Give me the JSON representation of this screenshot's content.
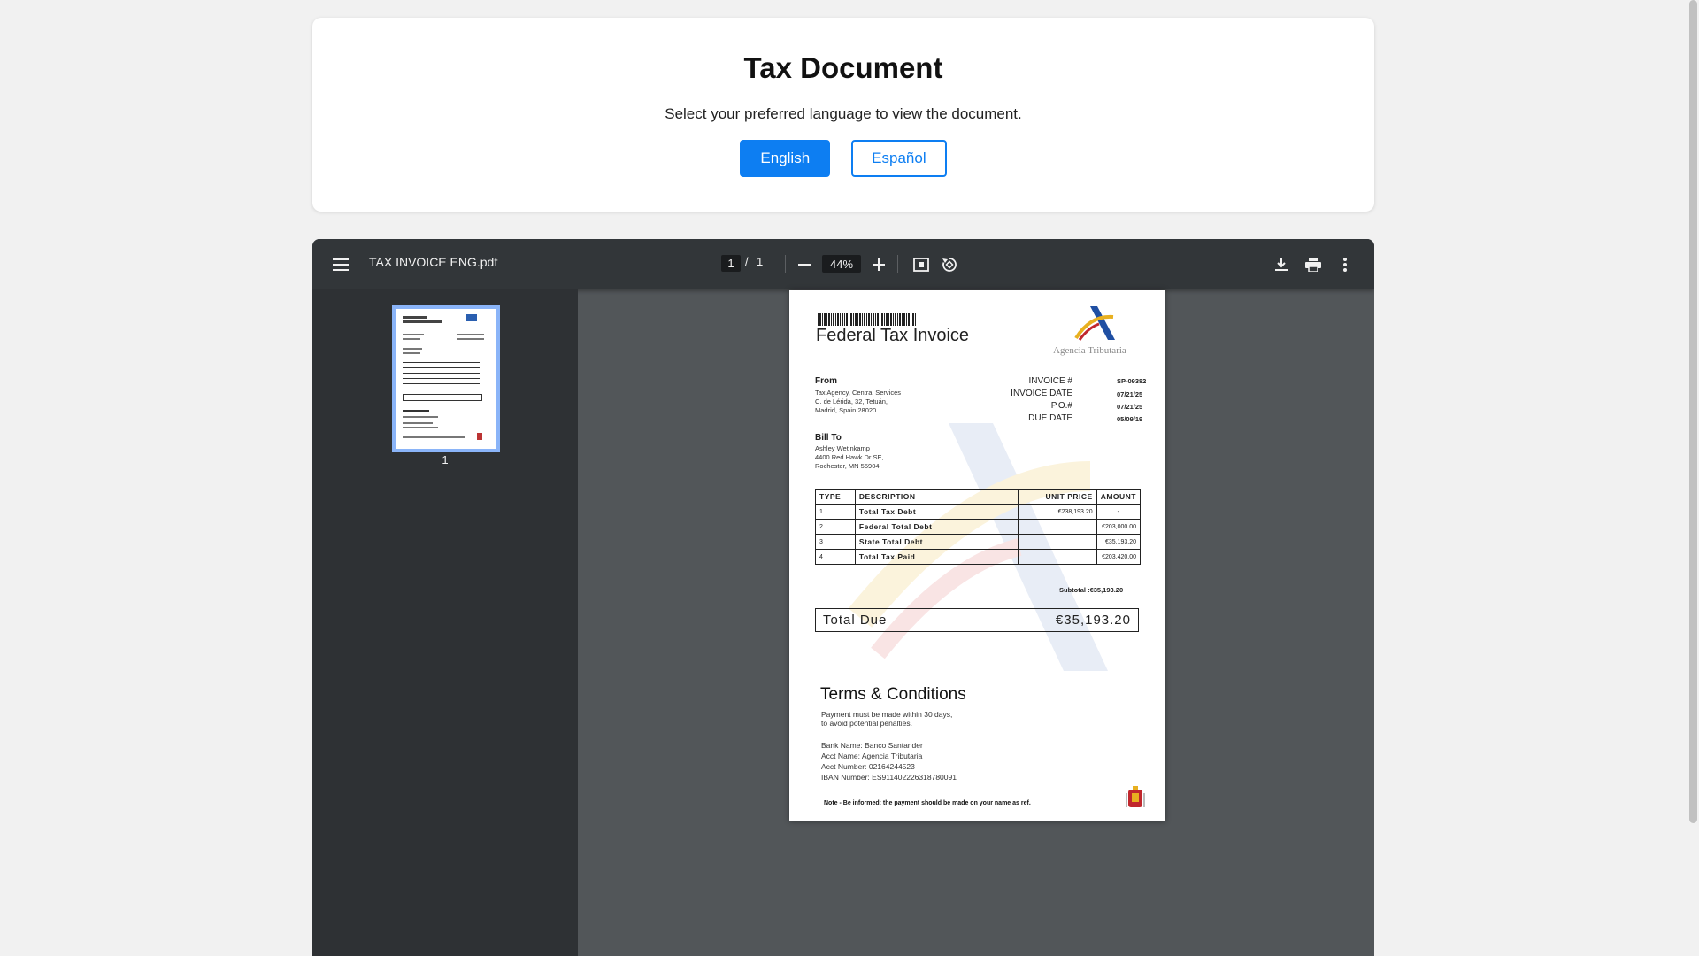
{
  "header": {
    "title": "Tax Document",
    "subtitle": "Select your preferred language to view the document.",
    "english_label": "English",
    "spanish_label": "Español"
  },
  "viewer": {
    "filename": "TAX INVOICE ENG.pdf",
    "page_current": "1",
    "page_sep": "/",
    "page_total": "1",
    "zoom": "44%",
    "thumbnail_label": "1"
  },
  "invoice": {
    "title": "Federal Tax Invoice",
    "agency_logo_text": "Agencia Tributaria",
    "from_label": "From",
    "from_lines": [
      "Tax Agency, Central Services",
      "C. de Lérida, 32, Tetuán,",
      "Madrid, Spain 28020"
    ],
    "meta": [
      {
        "label": "INVOICE #",
        "value": "SP-09382"
      },
      {
        "label": "INVOICE DATE",
        "value": "07/21/25"
      },
      {
        "label": "P.O.#",
        "value": "07/21/25"
      },
      {
        "label": "DUE DATE",
        "value": "05/09/19"
      }
    ],
    "billto_label": "Bill To",
    "billto_lines": [
      "Ashley Wetinkamp",
      "4400 Red Hawk Dr SE,",
      "Rochester, MN 55904"
    ],
    "table_headers": [
      "TYPE",
      "DESCRIPTION",
      "UNIT PRICE",
      "AMOUNT"
    ],
    "rows": [
      {
        "type": "1",
        "desc": "Total Tax Debt",
        "unit": "€238,193.20",
        "amount": "-"
      },
      {
        "type": "2",
        "desc": "Federal Total Debt",
        "unit": "",
        "amount": "€203,000.00"
      },
      {
        "type": "3",
        "desc": "State Total Debt",
        "unit": "",
        "amount": "€35,193.20"
      },
      {
        "type": "4",
        "desc": "Total Tax Paid",
        "unit": "",
        "amount": "€203,420.00"
      }
    ],
    "subtotal": "Subtotal :€35,193.20",
    "total_label": "Total Due",
    "total_value": "€35,193.20",
    "terms_title": "Terms & Conditions",
    "terms_lines": [
      "Payment must be made within 30 days,",
      "to avoid potential penalties."
    ],
    "bank_lines": [
      "Bank Name: Banco Santander",
      "Acct Name: Agencia Tributaria",
      "Acct Number: 02164244523",
      "IBAN Number: ES911402226318780091"
    ],
    "note": "Note - Be informed: the payment should be made on your name as ref."
  },
  "icons": [
    "menu-icon",
    "zoom-out-icon",
    "zoom-in-icon",
    "fit-page-icon",
    "rotate-icon",
    "download-icon",
    "print-icon",
    "more-options-icon"
  ],
  "colors": {
    "accent": "#0d7ef2",
    "toolbar": "#323639",
    "viewer_bg": "#525659",
    "sidebar": "#2e3134"
  }
}
